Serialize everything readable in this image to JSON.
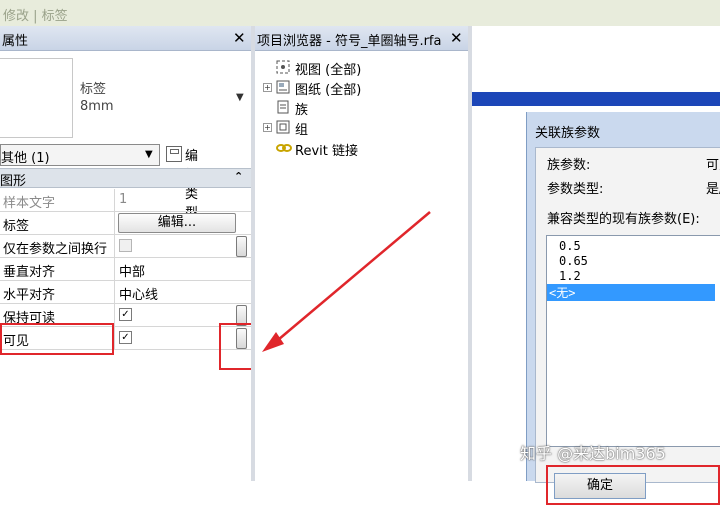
{
  "topbar": {
    "text": "修改 | 标签"
  },
  "properties": {
    "title": "属性",
    "close": "✕",
    "type_name": "标签",
    "type_size": "8mm",
    "instance_selector": "其他 (1)",
    "edit_type": "编辑类型",
    "group": "图形",
    "group_chevron": "⌃",
    "rows": [
      {
        "key": "样本文字",
        "value": "1"
      },
      {
        "key": "标签",
        "button": "编辑..."
      },
      {
        "key": "仅在参数之间换行"
      },
      {
        "key": "垂直对齐",
        "value": "中部"
      },
      {
        "key": "水平对齐",
        "value": "中心线"
      },
      {
        "key": "保持可读",
        "check": "✓"
      },
      {
        "key": "可见",
        "check": "✓"
      }
    ]
  },
  "browser": {
    "title": "项目浏览器 - 符号_单圈轴号.rfa",
    "close": "✕",
    "items": [
      {
        "label": "视图 (全部)",
        "expand": ""
      },
      {
        "label": "图纸 (全部)",
        "expand": "+"
      },
      {
        "label": "族",
        "expand": ""
      },
      {
        "label": "组",
        "expand": "+"
      },
      {
        "label": "Revit 链接",
        "expand": ""
      }
    ]
  },
  "dialog": {
    "title": "关联族参数",
    "family_param_label": "族参数:",
    "family_param_value": "可见",
    "param_type_label": "参数类型:",
    "param_type_value": "是/否",
    "compatible_label": "兼容类型的现有族参数(E):",
    "list": [
      "0.5",
      "0.65",
      "1.2",
      "<无>"
    ],
    "ok_button": "确定"
  },
  "watermark": "知乎 @来达bim365",
  "colors": {
    "highlight_box": "#e0262b",
    "arrow": "#e0262b",
    "title_bar": "#c9d4e6"
  }
}
